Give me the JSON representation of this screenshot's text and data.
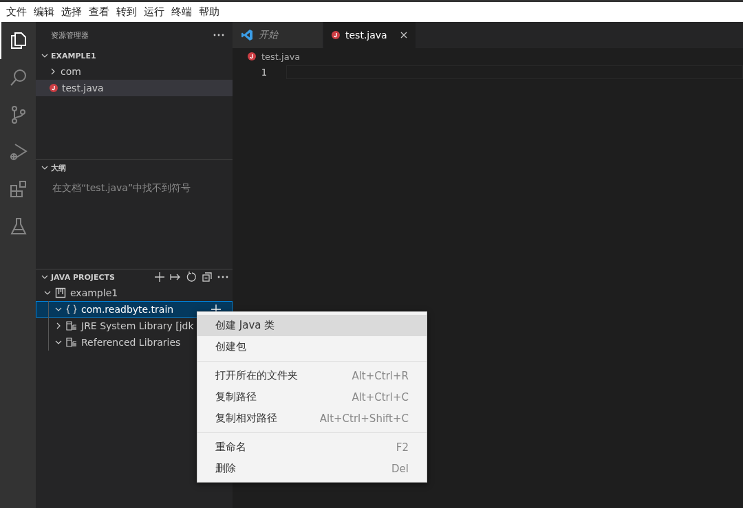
{
  "menu_bar": [
    "文件",
    "编辑",
    "选择",
    "查看",
    "转到",
    "运行",
    "终端",
    "帮助"
  ],
  "activity_bar": [
    {
      "kind": "files",
      "selected": true
    },
    {
      "kind": "search",
      "selected": false
    },
    {
      "kind": "source-control",
      "selected": false
    },
    {
      "kind": "run-debug",
      "selected": false
    },
    {
      "kind": "extensions",
      "selected": false
    },
    {
      "kind": "testing",
      "selected": false
    }
  ],
  "explorer": {
    "title": "资源管理器",
    "folder": {
      "label": "EXAMPLE1",
      "expanded": true,
      "items": [
        {
          "kind": "folder",
          "label": "com",
          "expanded": false,
          "selected": false
        },
        {
          "kind": "java",
          "label": "test.java",
          "selected": true
        }
      ]
    }
  },
  "outline": {
    "title": "大纲",
    "expanded": true,
    "message": "在文档“test.java”中找不到符号"
  },
  "java_projects": {
    "title": "JAVA PROJECTS",
    "expanded": true,
    "tree": [
      {
        "kind": "project",
        "label": "example1",
        "expanded": true,
        "selected": false,
        "children": [
          {
            "kind": "package",
            "label": "com.readbyte.train",
            "expanded": true,
            "selected": true
          },
          {
            "kind": "library",
            "label": "JRE System Library [jdk",
            "expanded": false,
            "selected": false
          },
          {
            "kind": "library",
            "label": "Referenced Libraries",
            "expanded": true,
            "selected": false
          }
        ]
      }
    ]
  },
  "tabs": [
    {
      "kind": "welcome",
      "label": "开始",
      "selected": false,
      "closable": false
    },
    {
      "kind": "java",
      "label": "test.java",
      "selected": true,
      "closable": true
    }
  ],
  "breadcrumb": "test.java",
  "line_numbers": [
    "1"
  ],
  "context_menu": [
    [
      {
        "label": "创建 Java 类",
        "selected": true
      },
      {
        "label": "创建包",
        "selected": false
      }
    ],
    [
      {
        "label": "打开所在的文件夹",
        "shortcut": "Alt+Ctrl+R",
        "selected": false
      },
      {
        "label": "复制路径",
        "shortcut": "Alt+Ctrl+C",
        "selected": false
      },
      {
        "label": "复制相对路径",
        "shortcut": "Alt+Ctrl+Shift+C",
        "selected": false
      }
    ],
    [
      {
        "label": "重命名",
        "shortcut": "F2",
        "selected": false
      },
      {
        "label": "删除",
        "shortcut": "Del",
        "selected": false
      }
    ]
  ]
}
